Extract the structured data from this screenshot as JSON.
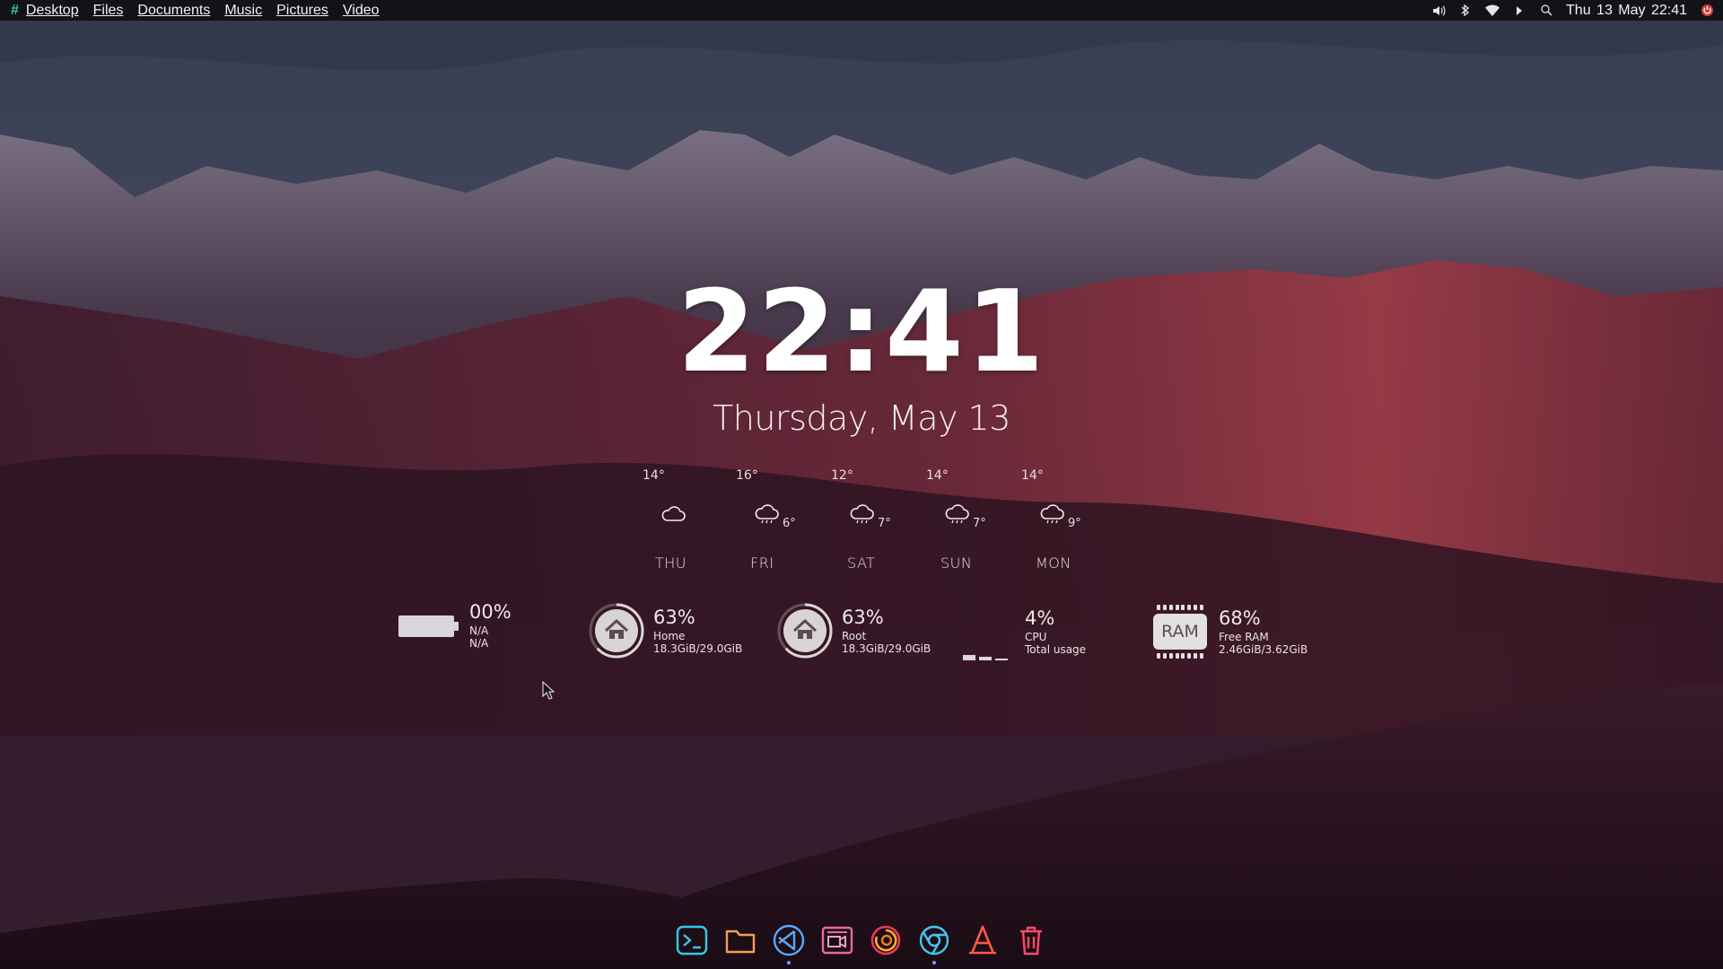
{
  "topbar": {
    "logo": "#",
    "menus": [
      {
        "label": "Desktop"
      },
      {
        "label": "Files"
      },
      {
        "label": "Documents"
      },
      {
        "label": "Music"
      },
      {
        "label": "Pictures"
      },
      {
        "label": "Video"
      }
    ],
    "tray_icons": [
      "volume-icon",
      "bluetooth-icon",
      "wifi-icon",
      "play-icon",
      "search-icon"
    ],
    "clock": "Thu 13 May  22:41",
    "power_icon": "power-icon"
  },
  "clock_widget": {
    "time": "22:41",
    "date": "Thursday, May 13"
  },
  "weather": [
    {
      "day": "THU",
      "high": "14°",
      "low": "",
      "icon": "cloud-icon"
    },
    {
      "day": "FRI",
      "high": "16°",
      "low": "6°",
      "icon": "rain-cloud-icon"
    },
    {
      "day": "SAT",
      "high": "12°",
      "low": "7°",
      "icon": "rain-cloud-icon"
    },
    {
      "day": "SUN",
      "high": "14°",
      "low": "7°",
      "icon": "rain-cloud-icon"
    },
    {
      "day": "MON",
      "high": "14°",
      "low": "9°",
      "icon": "rain-cloud-icon"
    }
  ],
  "stats": {
    "battery": {
      "pct": "00%",
      "line1": "N/A",
      "line2": "N/A",
      "level": 0,
      "icon": "battery-icon"
    },
    "home": {
      "pct": "63%",
      "line1": "Home",
      "line2": "18.3GiB/29.0GiB",
      "level": 0.63,
      "icon": "home-icon"
    },
    "root": {
      "pct": "63%",
      "line1": "Root",
      "line2": "18.3GiB/29.0GiB",
      "level": 0.63,
      "icon": "home-icon"
    },
    "cpu": {
      "pct": "4%",
      "line1": "CPU",
      "line2": "Total usage",
      "level": 0.04,
      "icon": "cpu-bars-icon"
    },
    "ram": {
      "pct": "68%",
      "line1": "Free RAM",
      "line2": "2.46GiB/3.62GiB",
      "chip_label": "RAM",
      "level": 0.68,
      "icon": "ram-chip-icon"
    }
  },
  "dock": [
    {
      "name": "terminal",
      "icon": "terminal-icon",
      "color": "#35c8e8",
      "running": false
    },
    {
      "name": "files",
      "icon": "folder-icon",
      "color": "#f0a050",
      "running": false
    },
    {
      "name": "vscode",
      "icon": "vscode-icon",
      "color": "#5aa8ff",
      "running": true
    },
    {
      "name": "screen-recorder",
      "icon": "video-recorder-icon",
      "color": "#e86aa0",
      "running": false
    },
    {
      "name": "firefox",
      "icon": "firefox-icon",
      "color": "#ffb020",
      "running": false
    },
    {
      "name": "chrome",
      "icon": "chrome-icon",
      "color": "#40c8f0",
      "running": true
    },
    {
      "name": "software-center",
      "icon": "app-store-icon",
      "color": "#ff5a4a",
      "running": false
    },
    {
      "name": "trash",
      "icon": "trash-icon",
      "color": "#ff4a6a",
      "running": false
    }
  ],
  "colors": {
    "topbar_bg": "#121317",
    "accent": "#35c8a8"
  }
}
